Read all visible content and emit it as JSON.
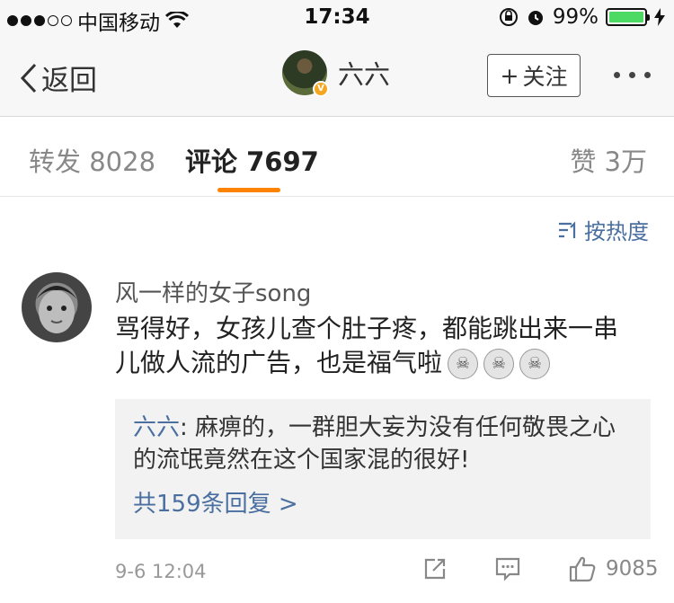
{
  "status_bar": {
    "carrier": "中国移动",
    "time": "17:34",
    "battery_percent": "99%",
    "battery_level": 0.99
  },
  "nav": {
    "back_label": "返回",
    "profile_name": "六六",
    "follow_label": "关注",
    "follow_icon": "+"
  },
  "tabs": {
    "repost": "转发 8028",
    "comment": "评论 7697",
    "like": "赞 3万"
  },
  "sort": {
    "label": "按热度"
  },
  "comment": {
    "user": "风一样的女子song",
    "text": "骂得好，女孩儿查个肚子疼，都能跳出来一串儿做人流的广告，也是福气啦",
    "emoji_count": 3,
    "reply": {
      "author": "六六",
      "separator": ": ",
      "text": "麻痹的，一群胆大妄为没有任何敬畏之心的流氓竟然在这个国家混的很好!",
      "more_label": "共159条回复 >"
    },
    "time": "9-6 12:04",
    "like_count": "9085"
  },
  "colors": {
    "accent": "#ff8200",
    "link": "#4a6fa0",
    "battery": "#4cd964"
  }
}
